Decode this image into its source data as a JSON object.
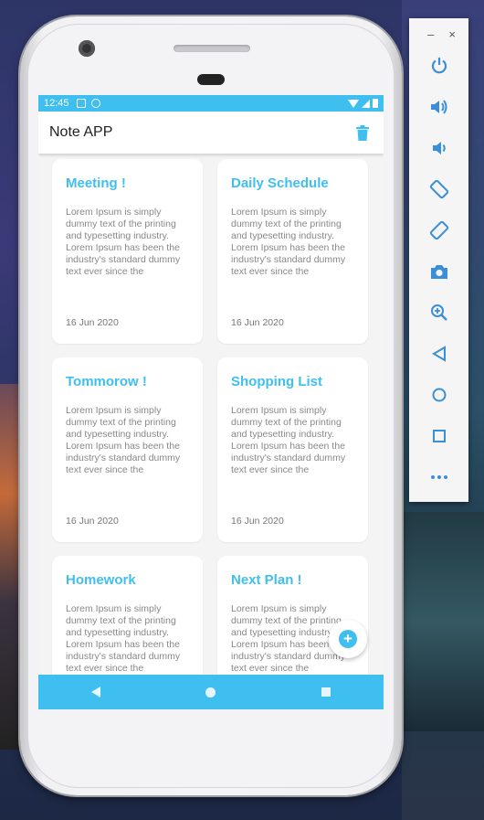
{
  "status_bar": {
    "time": "12:45"
  },
  "app_bar": {
    "title": "Note APP",
    "delete_icon": "trash-icon"
  },
  "notes": [
    {
      "title": "Meeting !",
      "body": "Lorem Ipsum is simply dummy text of the printing and typesetting industry. Lorem Ipsum has been the industry's standard dummy text ever since the",
      "date": "16 Jun 2020"
    },
    {
      "title": "Daily Schedule",
      "body": "Lorem Ipsum is simply dummy text of the printing and typesetting industry. Lorem Ipsum has been the industry's standard dummy text ever since the",
      "date": "16 Jun 2020"
    },
    {
      "title": "Tommorow !",
      "body": "Lorem Ipsum is simply dummy text of the printing and typesetting industry. Lorem Ipsum has been the industry's standard dummy text ever since the",
      "date": "16 Jun 2020"
    },
    {
      "title": "Shopping List",
      "body": "Lorem Ipsum is simply dummy text of the printing and typesetting industry. Lorem Ipsum has been the industry's standard dummy text ever since the",
      "date": "16 Jun 2020"
    },
    {
      "title": "Homework",
      "body": "Lorem Ipsum is simply dummy text of the printing and typesetting industry. Lorem Ipsum has been the industry's standard dummy text ever since the",
      "date": ""
    },
    {
      "title": "Next Plan !",
      "body": "Lorem Ipsum is simply dummy text of the printing and typesetting industry. Lorem Ipsum has been the industry's standard dummy text ever since the",
      "date": ""
    }
  ],
  "fab": {
    "label": "+"
  },
  "emulator_toolbar": {
    "minimize_label": "–",
    "close_label": "×",
    "buttons": [
      "power-icon",
      "volume-up-icon",
      "volume-down-icon",
      "rotate-left-icon",
      "rotate-right-icon",
      "camera-icon",
      "zoom-icon",
      "back-icon",
      "home-icon",
      "overview-icon",
      "more-icon"
    ]
  },
  "colors": {
    "accent": "#3fbff0",
    "card_bg": "#ffffff",
    "screen_bg": "#f4f4f4"
  }
}
